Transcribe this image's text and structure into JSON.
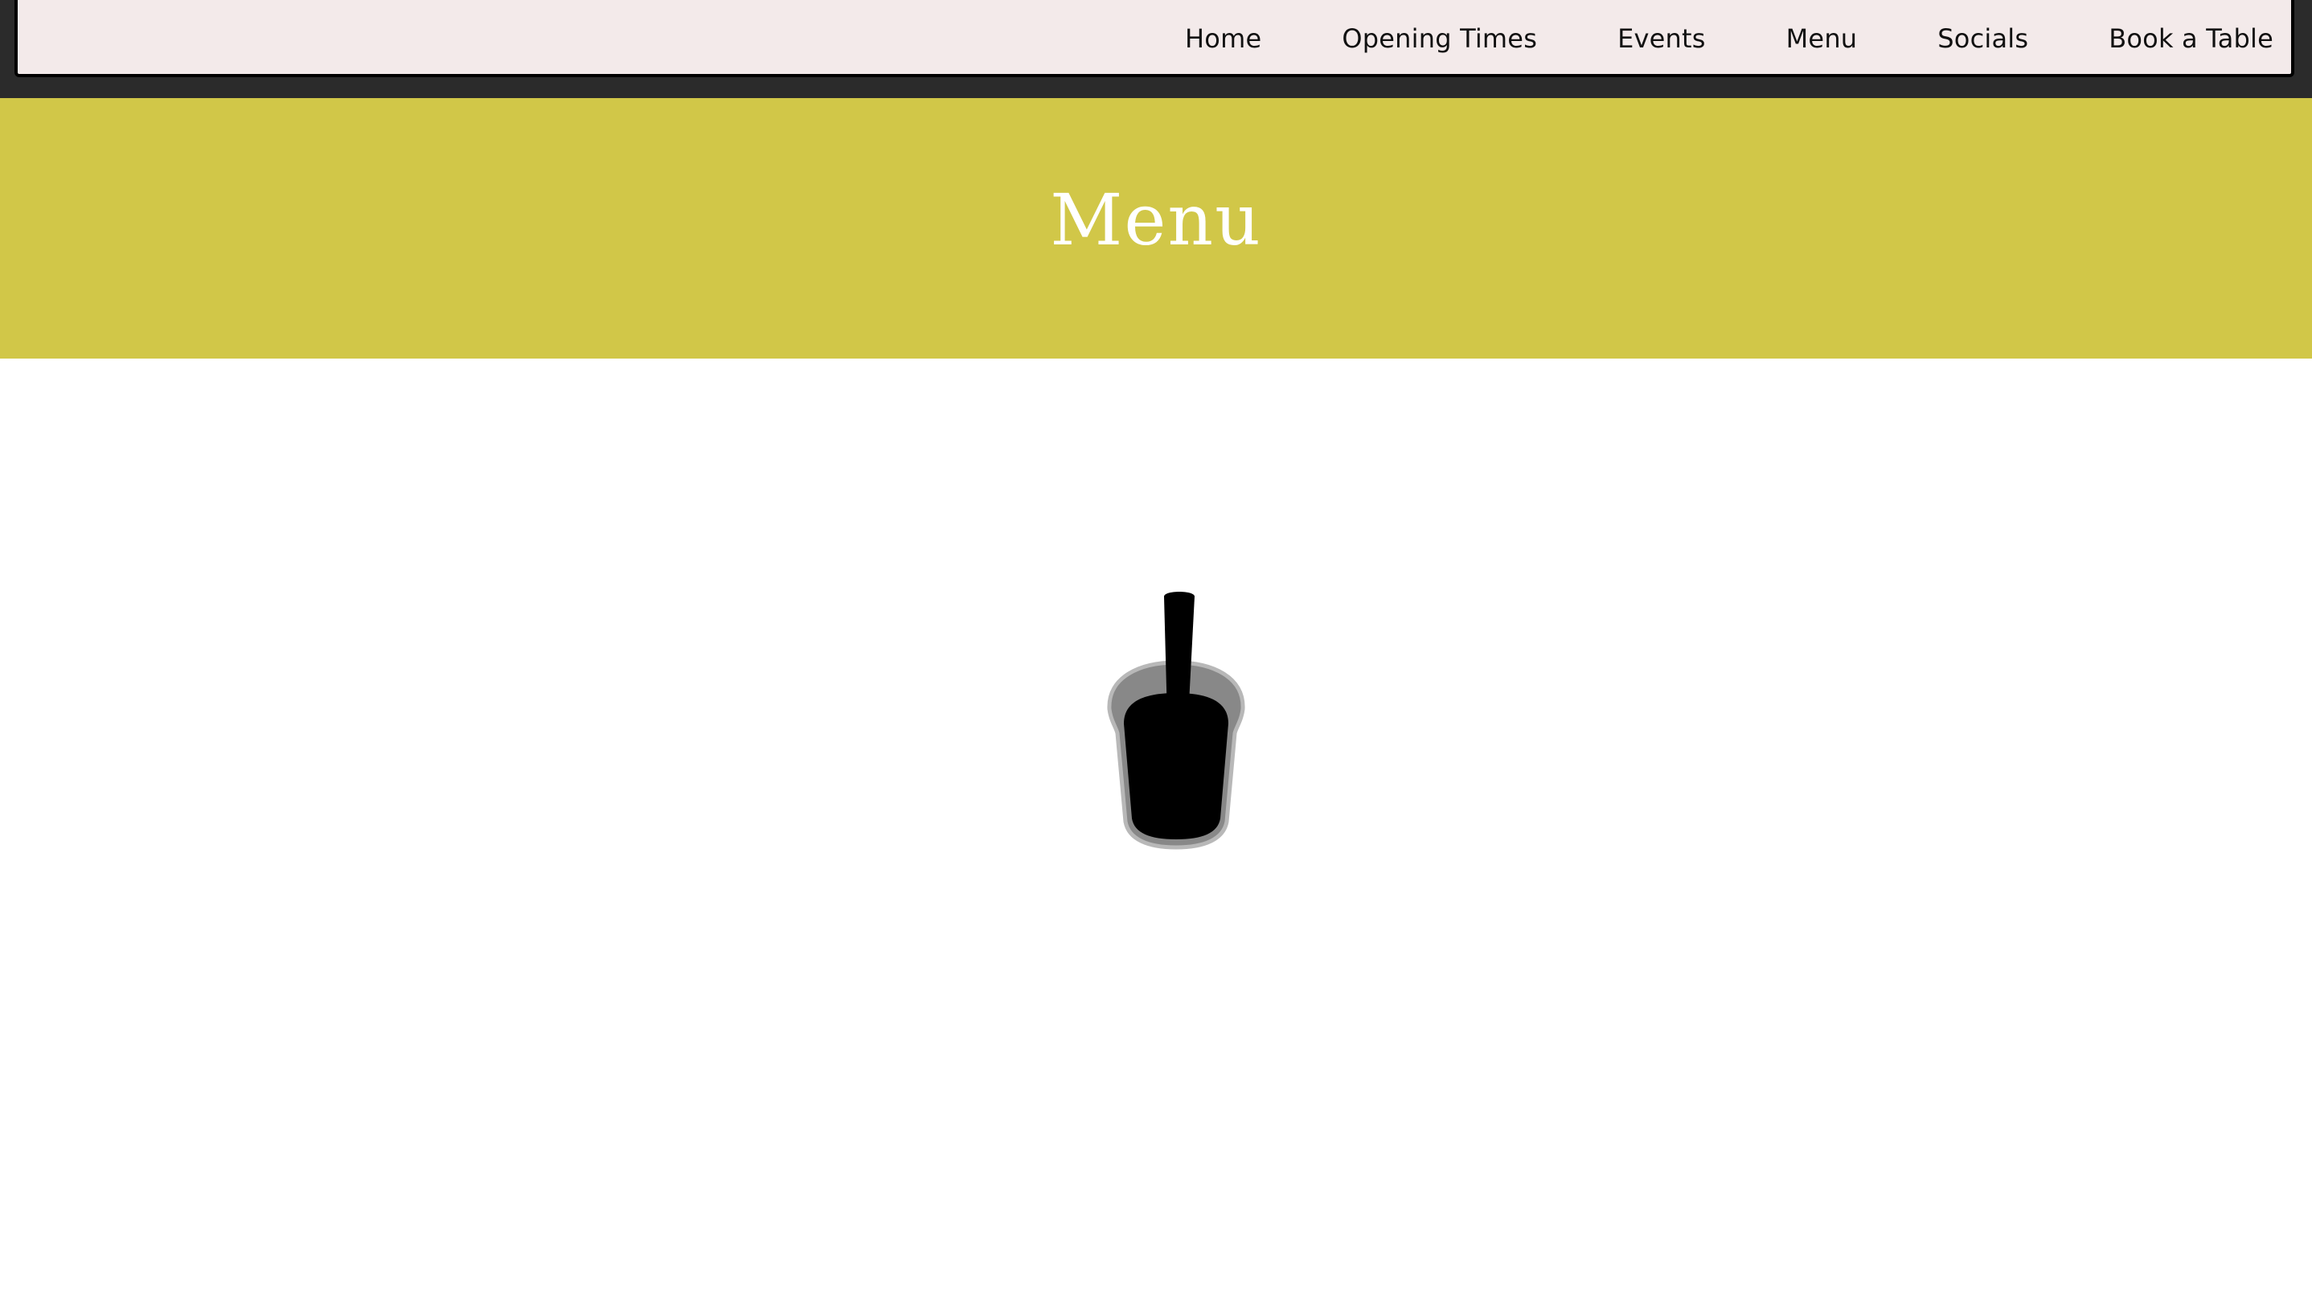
{
  "nav": {
    "items": [
      {
        "label": "Home"
      },
      {
        "label": "Opening Times"
      },
      {
        "label": "Events"
      },
      {
        "label": "Menu"
      },
      {
        "label": "Socials"
      },
      {
        "label": "Book a Table"
      }
    ]
  },
  "banner": {
    "title": "Menu"
  },
  "main": {
    "icon": "drink-cup-icon"
  },
  "colors": {
    "top_bar": "#2b2b2b",
    "nav_panel": "#f3eaea",
    "banner": "#d1c748",
    "banner_text": "#ffffff",
    "nav_text": "#111111"
  }
}
